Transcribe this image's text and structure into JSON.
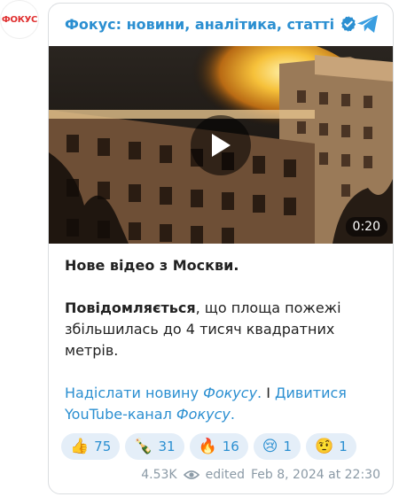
{
  "channel": {
    "avatar_text": "ФОКУС",
    "name": "Фокус: новини, аналітика, статті"
  },
  "video": {
    "duration": "0:20"
  },
  "message": {
    "line1": "Нове відео з Москви.",
    "bold_word": "Повідомляється",
    "body_rest": ", що площа пожежі збільшилась до 4 тисяч квадратних метрів.",
    "link1": "Надіслати новину ",
    "link1_italic": "Фокусу",
    "link1_end": ".",
    "separator": " I ",
    "link2": "Дивитися YouTube-канал ",
    "link2_italic": "Фокусу",
    "link2_end": "."
  },
  "reactions": [
    {
      "emoji": "👍",
      "count": "75"
    },
    {
      "emoji": "🍾",
      "count": "31"
    },
    {
      "emoji": "🔥",
      "count": "16"
    },
    {
      "emoji": "😢",
      "count": "1"
    },
    {
      "emoji": "🤨",
      "count": "1"
    }
  ],
  "meta": {
    "views": "4.53K",
    "edited_label": "edited",
    "date": "Feb 8, 2024 at 22:30"
  },
  "colors": {
    "accent": "#2b8fd1",
    "reaction_bg": "#e4eef8",
    "meta": "#8b9aa6"
  }
}
